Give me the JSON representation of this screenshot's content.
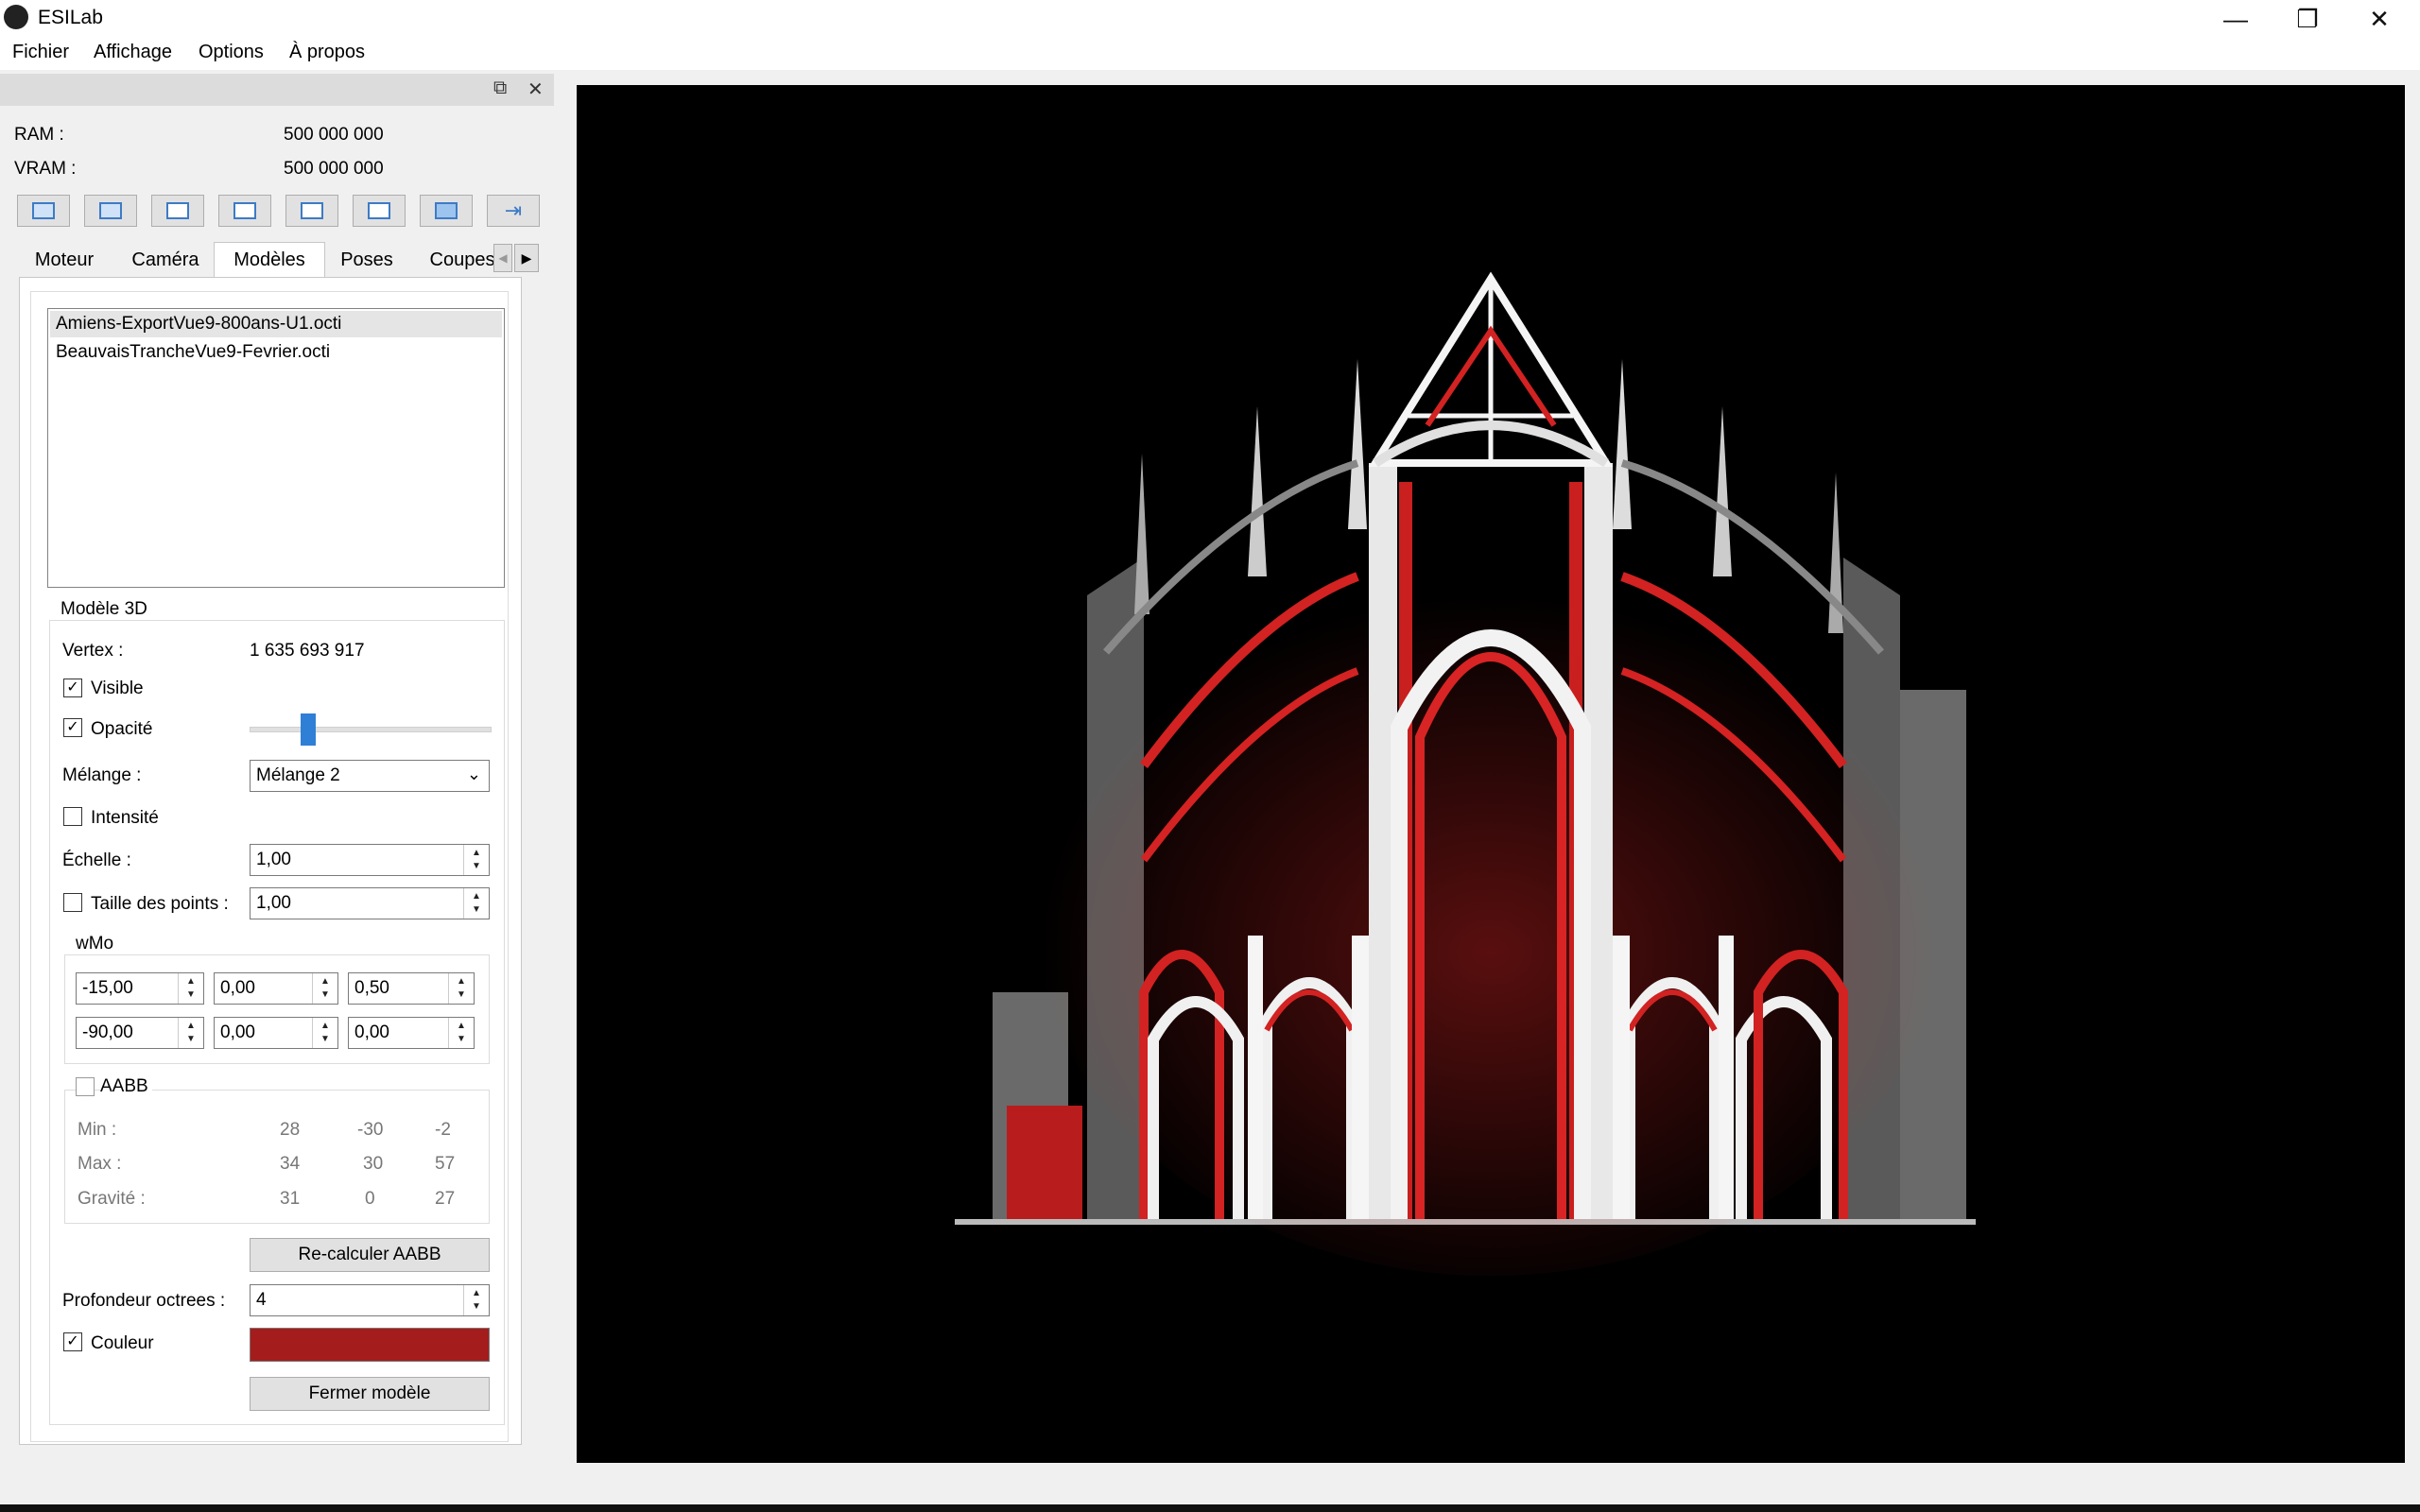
{
  "window": {
    "title": "ESILab"
  },
  "menu": [
    "Fichier",
    "Affichage",
    "Options",
    "À propos"
  ],
  "memory": {
    "ram_label": "RAM :",
    "ram_value": "500 000 000",
    "vram_label": "VRAM :",
    "vram_value": "500 000 000"
  },
  "tabs": [
    "Moteur",
    "Caméra",
    "Modèles",
    "Poses",
    "Coupes"
  ],
  "models": [
    "Amiens-ExportVue9-800ans-U1.octi",
    "BeauvaisTrancheVue9-Fevrier.octi"
  ],
  "model3d": {
    "group_title": "Modèle 3D",
    "vertex_label": "Vertex :",
    "vertex_value": "1 635 693 917",
    "visible_label": "Visible",
    "opacity_label": "Opacité",
    "opacity_level": 0.25,
    "blend_label": "Mélange :",
    "blend_value": "Mélange 2",
    "intensity_label": "Intensité",
    "scale_label": "Échelle :",
    "scale_value": "1,00",
    "pointsize_label": "Taille des points :",
    "pointsize_value": "1,00",
    "wmo_title": "wMo",
    "wmo_row1": [
      "-15,00",
      "0,00",
      "0,50"
    ],
    "wmo_row2": [
      "-90,00",
      "0,00",
      "0,00"
    ],
    "aabb_label": "AABB",
    "aabb_min_label": "Min :",
    "aabb_min": [
      "28",
      "-30",
      "-2"
    ],
    "aabb_max_label": "Max :",
    "aabb_max": [
      "34",
      "30",
      "57"
    ],
    "aabb_grav_label": "Gravité :",
    "aabb_grav": [
      "31",
      "0",
      "27"
    ],
    "recalc_label": "Re-calculer AABB",
    "depth_label": "Profondeur octrees :",
    "depth_value": "4",
    "color_label": "Couleur",
    "color_hex": "#a51c1c",
    "close_label": "Fermer modèle"
  }
}
